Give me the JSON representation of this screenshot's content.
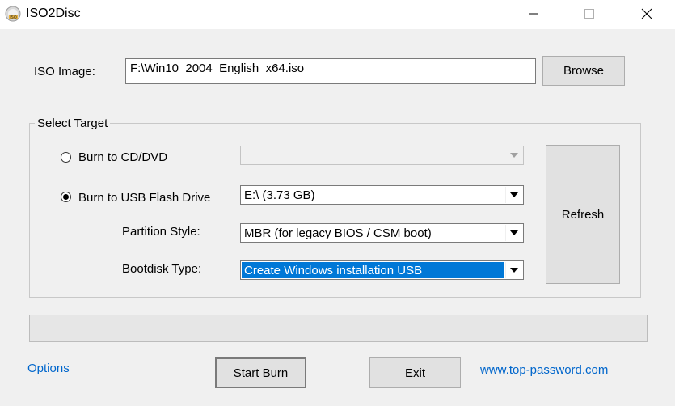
{
  "window": {
    "title": "ISO2Disc",
    "icon_label": "ISO"
  },
  "iso": {
    "label": "ISO Image:",
    "path": "F:\\Win10_2004_English_x64.iso",
    "browse_label": "Browse"
  },
  "target": {
    "group_label": "Select Target",
    "cd_label": "Burn to CD/DVD",
    "cd_selected": false,
    "cd_drive": "",
    "usb_label": "Burn to USB Flash Drive",
    "usb_selected": true,
    "usb_drive": "E:\\ (3.73 GB)",
    "partition_label": "Partition Style:",
    "partition_value": "MBR (for legacy BIOS / CSM boot)",
    "bootdisk_label": "Bootdisk Type:",
    "bootdisk_value": "Create Windows installation USB",
    "refresh_label": "Refresh"
  },
  "progress": {
    "value": 0
  },
  "footer": {
    "options_label": "Options",
    "start_label": "Start Burn",
    "exit_label": "Exit",
    "website": "www.top-password.com"
  },
  "colors": {
    "accent": "#0078d7",
    "link": "#0066cc"
  }
}
